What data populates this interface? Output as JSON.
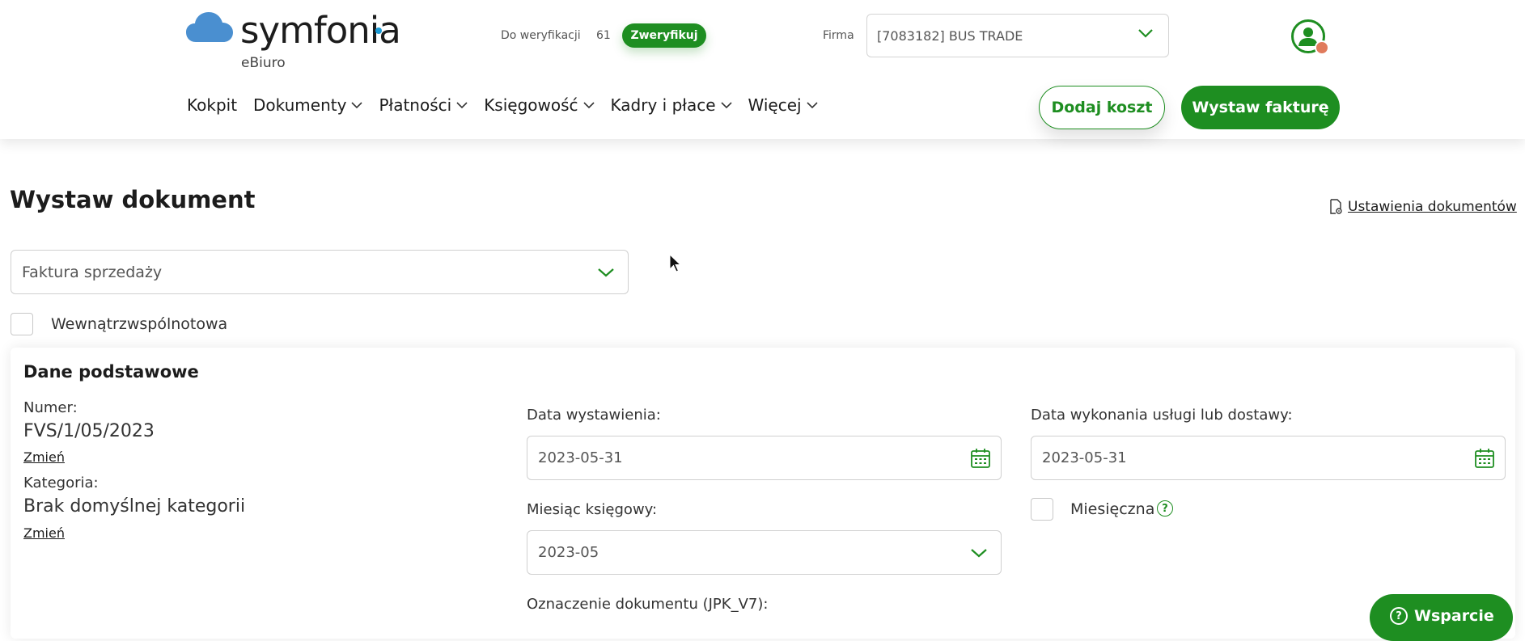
{
  "header": {
    "brand": "symfonia",
    "product": "eBiuro",
    "verification": {
      "label": "Do weryfikacji",
      "count": "61",
      "button": "Zweryfikuj"
    },
    "company": {
      "label": "Firma",
      "value": "[7083182] BUS TRADE"
    },
    "nav": [
      "Kokpit",
      "Dokumenty",
      "Płatności",
      "Księgowość",
      "Kadry i płace",
      "Więcej"
    ],
    "add_cost_button": "Dodaj koszt",
    "issue_invoice_button": "Wystaw fakturę"
  },
  "page": {
    "title": "Wystaw dokument",
    "settings_link": "Ustawienia dokumentów",
    "document_type": "Faktura sprzedaży",
    "intra_community_label": "Wewnątrzwspólnotowa"
  },
  "basic": {
    "title": "Dane podstawowe",
    "number_label": "Numer:",
    "number_value": "FVS/1/05/2023",
    "change_link": "Zmień",
    "category_label": "Kategoria:",
    "category_value": "Brak domyślnej kategorii",
    "issue_date_label": "Data wystawienia:",
    "issue_date": "2023-05-31",
    "delivery_date_label": "Data wykonania usługi lub dostawy:",
    "delivery_date": "2023-05-31",
    "accounting_month_label": "Miesiąc księgowy:",
    "accounting_month": "2023-05",
    "monthly_label": "Miesięczna",
    "jpk_label": "Oznaczenie dokumentu (JPK_V7):"
  },
  "support_button": "Wsparcie",
  "colors": {
    "accent": "#1e8e21",
    "brand_cloud": "#4a8fd0",
    "brand_dot": "#1b9bd5",
    "avatar_dot": "#e07b5c"
  },
  "icons": [
    "cloud-logo-icon",
    "chevron-down-icon",
    "user-avatar-icon",
    "settings-document-icon",
    "calendar-icon",
    "help-icon",
    "question-icon",
    "mouse-cursor-icon"
  ]
}
